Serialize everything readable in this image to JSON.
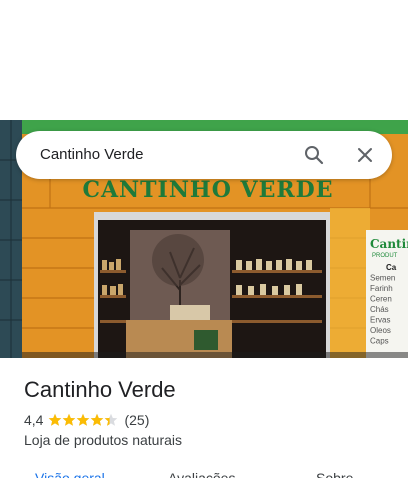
{
  "search": {
    "query": "Cantinho Verde",
    "icons": [
      "search-icon",
      "close-icon"
    ]
  },
  "hero_photo": {
    "sign_text": "CANTINHO VERDE",
    "side_sign_title": "Cantin",
    "side_sign_subtitle": "PRODUT",
    "side_sign_lines": [
      "Ca",
      "Semen",
      "Farinh",
      "Ceren",
      "Chás",
      "Ervas",
      "Oleos",
      "Caps"
    ]
  },
  "place": {
    "name": "Cantinho Verde",
    "rating": "4,4",
    "rating_stars": 4.4,
    "review_count": "(25)",
    "category": "Loja de produtos naturais"
  },
  "tabs": [
    {
      "label": "Visão geral",
      "active": true
    },
    {
      "label": "Avaliações",
      "active": false
    },
    {
      "label": "Sobre",
      "active": false
    }
  ],
  "colors": {
    "accent": "#1a73e8",
    "star": "#fbbc04",
    "sign_green": "#1f7a3a",
    "facade_orange": "#e08a1e"
  }
}
